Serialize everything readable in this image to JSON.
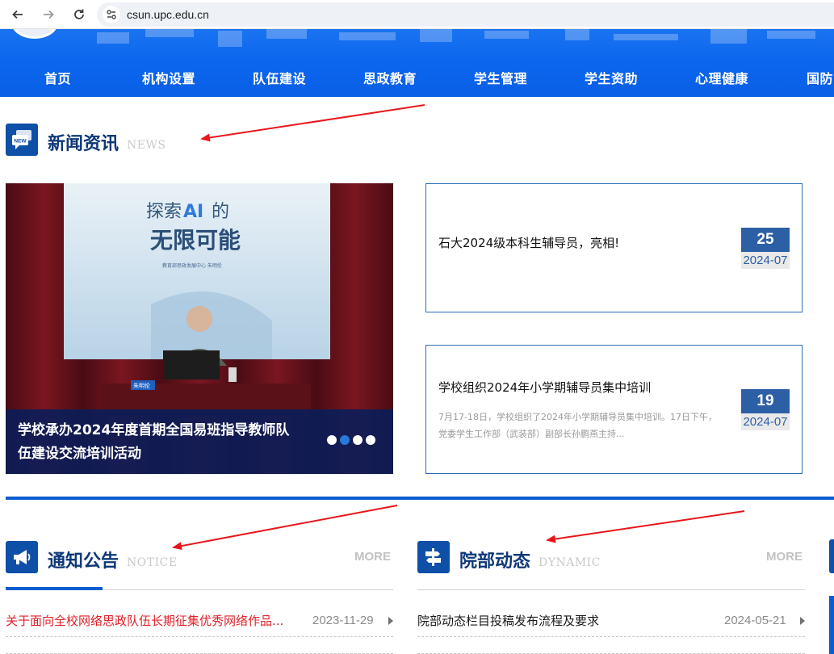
{
  "browser": {
    "url": "csun.upc.edu.cn",
    "icons": [
      "back-arrow-icon",
      "forward-arrow-icon",
      "reload-icon",
      "site-info-icon"
    ]
  },
  "nav": {
    "items": [
      "首页",
      "机构设置",
      "队伍建设",
      "思政教育",
      "学生管理",
      "学生资助",
      "心理健康",
      "国防"
    ]
  },
  "news": {
    "title": "新闻资讯",
    "title_en": "NEWS",
    "icon_label": "NEW",
    "carousel": {
      "slide_text_line1": "探索",
      "slide_text_ai": "AI",
      "slide_text_line1_end": "的",
      "slide_text_line2": "无限可能",
      "slide_subtitle": "教育部思政发展中心  朱明伦",
      "nameplate": "朱明伦",
      "caption": "学校承办2024年度首期全国易班指导教师队伍建设交流培训活动",
      "dots_total": 4,
      "dot_active": 2
    },
    "cards": [
      {
        "title": "石大2024级本科生辅导员，亮相!",
        "desc": "",
        "day": "25",
        "ym": "2024-07"
      },
      {
        "title": "学校组织2024年小学期辅导员集中培训",
        "desc": "7月17-18日，学校组织了2024年小学期辅导员集中培训。17日下午，党委学生工作部（武装部）副部长孙鹏燕主持...",
        "day": "19",
        "ym": "2024-07"
      }
    ]
  },
  "notice": {
    "title": "通知公告",
    "title_en": "NOTICE",
    "more": "MORE",
    "rows": [
      {
        "title": "关于面向全校网络思政队伍长期征集优秀网络作品...",
        "date": "2023-11-29",
        "highlight": true
      }
    ]
  },
  "dynamic": {
    "title": "院部动态",
    "title_en": "DYNAMIC",
    "more": "MORE",
    "rows": [
      {
        "title": "院部动态栏目投稿发布流程及要求",
        "date": "2024-05-21",
        "highlight": false
      }
    ]
  },
  "colors": {
    "nav_bg": "#0b66ee",
    "brand_blue": "#0e4fa8",
    "accent_blue": "#0a5cd1",
    "date_blue": "#2d5fa5",
    "notice_red": "#e0202a",
    "annotation_red": "#e8161b"
  }
}
